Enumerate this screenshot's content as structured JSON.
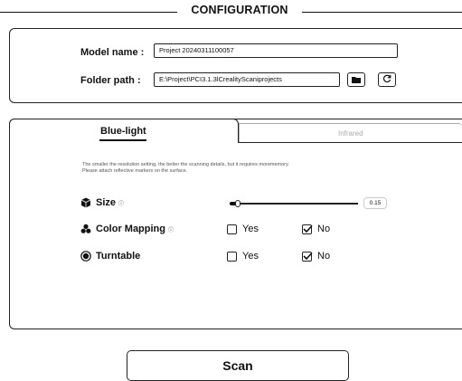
{
  "header": {
    "title": "CONFIGURATION"
  },
  "project": {
    "model_name_label": "Model name :",
    "model_name_value": "Project 20240311100057",
    "folder_path_label": "Folder path :",
    "folder_path_value": "E:\\Project\\PCI3.1.3lCrealityScaniprojects",
    "folder_button_icon": "folder-icon",
    "refresh_button_icon": "refresh-icon"
  },
  "tabs": [
    {
      "label": "Blue-light",
      "active": true
    },
    {
      "label": "Infrared",
      "active": false
    }
  ],
  "hint": {
    "line1": "The smaller the resolution setting, the better the scanning details, but it requires morememory.",
    "line2": "Please attach reflective markers on the surface."
  },
  "options": {
    "size": {
      "label": "Size",
      "info": "ⓘ",
      "value": "0.15",
      "fill_fraction": 0.06
    },
    "color_mapping": {
      "label": "Color Mapping",
      "info": "ⓘ",
      "yes_label": "Yes",
      "no_label": "No",
      "yes_checked": false,
      "no_checked": true
    },
    "turntable": {
      "label": "Turntable",
      "yes_label": "Yes",
      "no_label": "No",
      "yes_checked": false,
      "no_checked": true
    }
  },
  "actions": {
    "scan_label": "Scan"
  }
}
